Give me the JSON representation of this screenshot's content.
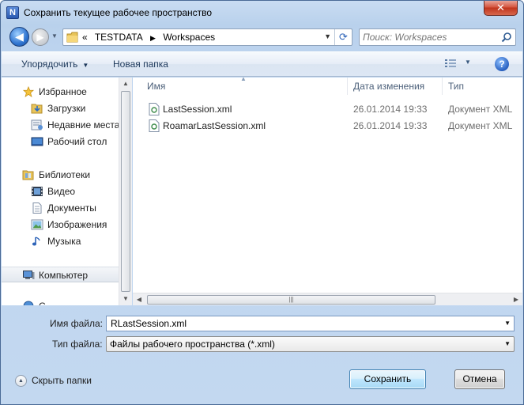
{
  "window": {
    "title": "Сохранить текущее рабочее пространство",
    "app_icon": "N",
    "close_label": "✕"
  },
  "address": {
    "prefix": "«",
    "crumbs": [
      "TESTDATA",
      "Workspaces"
    ],
    "separator": "▶"
  },
  "search": {
    "placeholder": "Поиск: Workspaces"
  },
  "toolbar": {
    "organize_label": "Упорядочить",
    "new_folder_label": "Новая папка",
    "help_label": "?"
  },
  "nav": {
    "favorites": "Избранное",
    "downloads": "Загрузки",
    "recent": "Недавние места",
    "desktop": "Рабочий стол",
    "libraries": "Библиотеки",
    "video": "Видео",
    "documents": "Документы",
    "pictures": "Изображения",
    "music": "Музыка",
    "computer": "Компьютер",
    "network_partial": "С..."
  },
  "columns": {
    "name": "Имя",
    "date": "Дата изменения",
    "type": "Тип"
  },
  "files": [
    {
      "name": "LastSession.xml",
      "date": "26.01.2014 19:33",
      "type": "Документ XML"
    },
    {
      "name": "RoamarLastSession.xml",
      "date": "26.01.2014 19:33",
      "type": "Документ XML"
    }
  ],
  "form": {
    "filename_label": "Имя файла:",
    "filename_value": "RLastSession.xml",
    "filetype_label": "Тип файла:",
    "filetype_value": "Файлы рабочего пространства (*.xml)"
  },
  "footer": {
    "hide_folders_label": "Скрыть папки",
    "save_label": "Сохранить",
    "cancel_label": "Отмена"
  }
}
